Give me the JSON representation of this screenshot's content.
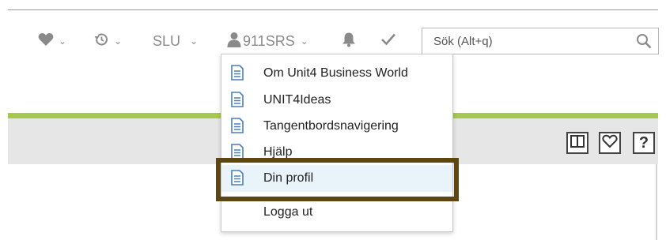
{
  "toolbar": {
    "favorites_icon": "heart-icon",
    "history_icon": "history-icon",
    "company": "SLU",
    "user_icon": "user-icon",
    "user": "911SRS",
    "notifications_icon": "bell-icon",
    "tasks_icon": "checkmark-icon",
    "chevron": "⌄"
  },
  "search": {
    "placeholder": "Sök (Alt+q)",
    "icon": "search-icon"
  },
  "user_menu": {
    "items": [
      {
        "label": "Om Unit4 Business World",
        "icon": "document-icon"
      },
      {
        "label": "UNIT4Ideas",
        "icon": "document-icon"
      },
      {
        "label": "Tangentbordsnavigering",
        "icon": "document-icon"
      },
      {
        "label": "Hjälp",
        "icon": "document-icon"
      },
      {
        "label": "Din profil",
        "icon": "document-icon"
      },
      {
        "label": "Logga ut",
        "icon": ""
      }
    ],
    "highlighted": "Din profil"
  },
  "panel_buttons": {
    "split_icon": "split-view-icon",
    "favorite_icon": "heart-outline-icon",
    "help_label": "?"
  },
  "colors": {
    "accent_green": "#a5c94a",
    "highlight_border": "#5e4514",
    "icon_blue": "#4a7fb6",
    "toolbar_gray": "#8a8a8a"
  }
}
